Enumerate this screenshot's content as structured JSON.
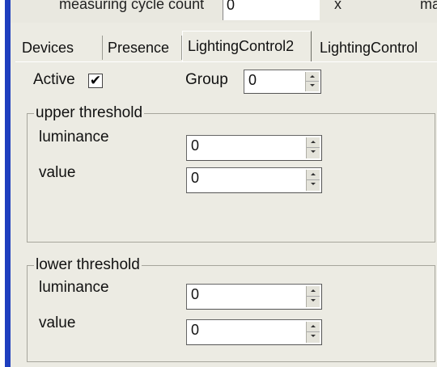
{
  "top_row": {
    "label": "measuring cycle count",
    "value": "0",
    "x_label": "x",
    "cut_label": "ma"
  },
  "tabs": [
    {
      "label": "Devices",
      "active": false
    },
    {
      "label": "Presence",
      "active": false
    },
    {
      "label": "LightingControl2",
      "active": true
    },
    {
      "label": "LightingControl",
      "active": false
    }
  ],
  "active_row": {
    "active_label": "Active",
    "active_checked": true,
    "checkmark": "✔",
    "group_label": "Group",
    "group_value": "0"
  },
  "upper_threshold": {
    "title": "upper threshold",
    "luminance_label": "luminance",
    "luminance_value": "0",
    "value_label": "value",
    "value_value": "0"
  },
  "lower_threshold": {
    "title": "lower threshold",
    "luminance_label": "luminance",
    "luminance_value": "0",
    "value_label": "value",
    "value_value": "0"
  },
  "colors": {
    "panel": "#ecebe3",
    "accent_bar": "#1f3fbf"
  }
}
